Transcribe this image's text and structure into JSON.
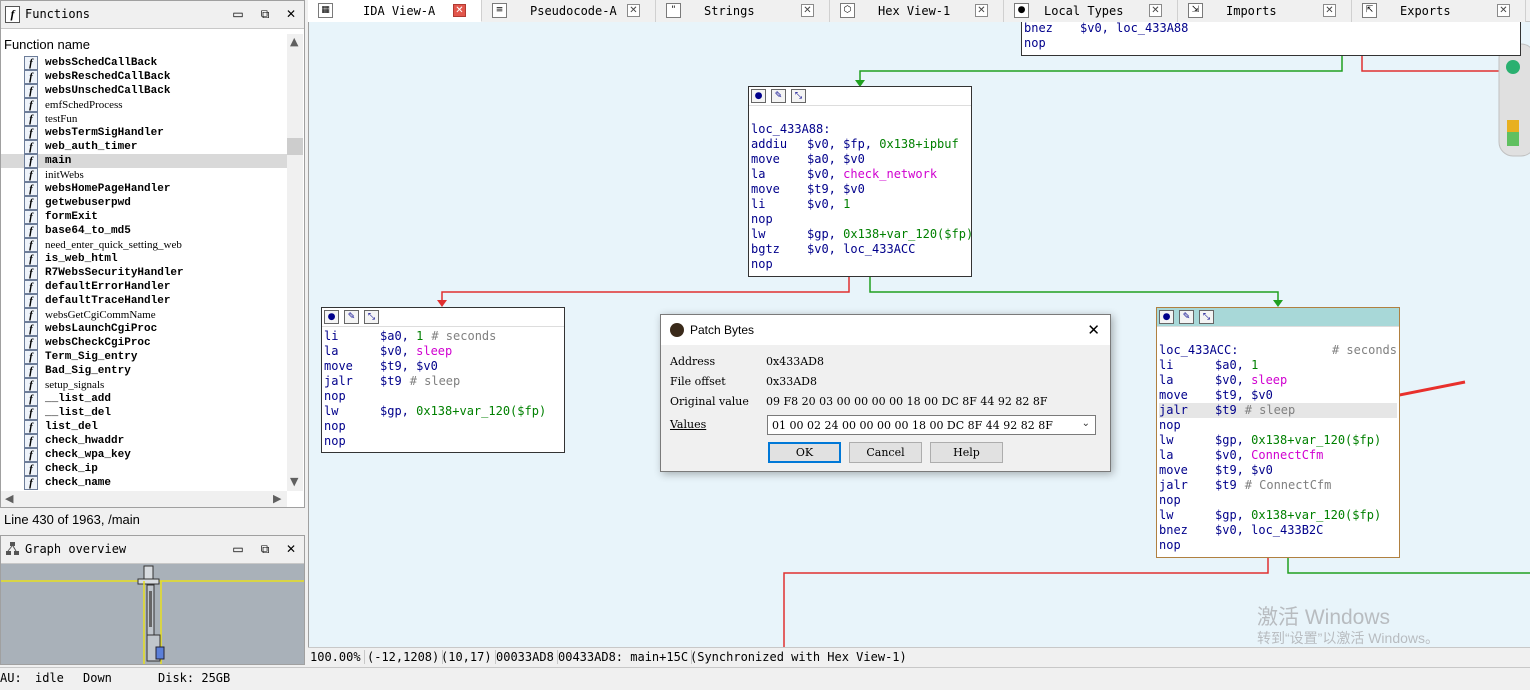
{
  "functions_panel": {
    "title": "Functions",
    "column_header": "Function name",
    "items": [
      {
        "name": "websSchedCallBack",
        "bold": true
      },
      {
        "name": "websReschedCallBack",
        "bold": true
      },
      {
        "name": "websUnschedCallBack",
        "bold": true
      },
      {
        "name": "emfSchedProcess",
        "bold": false
      },
      {
        "name": "testFun",
        "bold": false
      },
      {
        "name": "websTermSigHandler",
        "bold": true
      },
      {
        "name": "web_auth_timer",
        "bold": true
      },
      {
        "name": "main",
        "bold": true,
        "selected": true
      },
      {
        "name": "initWebs",
        "bold": false
      },
      {
        "name": "websHomePageHandler",
        "bold": true
      },
      {
        "name": "getwebuserpwd",
        "bold": true
      },
      {
        "name": "formExit",
        "bold": true
      },
      {
        "name": "base64_to_md5",
        "bold": true
      },
      {
        "name": "need_enter_quick_setting_web",
        "bold": false
      },
      {
        "name": "is_web_html",
        "bold": true
      },
      {
        "name": "R7WebsSecurityHandler",
        "bold": true
      },
      {
        "name": "defaultErrorHandler",
        "bold": true
      },
      {
        "name": "defaultTraceHandler",
        "bold": true
      },
      {
        "name": "websGetCgiCommName",
        "bold": false
      },
      {
        "name": "websLaunchCgiProc",
        "bold": true
      },
      {
        "name": "websCheckCgiProc",
        "bold": true
      },
      {
        "name": "Term_Sig_entry",
        "bold": true
      },
      {
        "name": "Bad_Sig_entry",
        "bold": true
      },
      {
        "name": "setup_signals",
        "bold": false
      },
      {
        "name": "__list_add",
        "bold": true
      },
      {
        "name": "__list_del",
        "bold": true
      },
      {
        "name": "list_del",
        "bold": true
      },
      {
        "name": "check_hwaddr",
        "bold": true
      },
      {
        "name": "check_wpa_key",
        "bold": true
      },
      {
        "name": "check_ip",
        "bold": true
      },
      {
        "name": "check_name",
        "bold": true
      }
    ],
    "line_status": "Line 430 of 1963, /main"
  },
  "graph_overview": {
    "title": "Graph overview"
  },
  "bottom_status": {
    "au_label": "AU:",
    "au_value": "idle",
    "direction": "Down",
    "disk": "Disk: 25GB"
  },
  "tabs": [
    {
      "label": "IDA View-A",
      "icon": "graph-icon",
      "active": true
    },
    {
      "label": "Pseudocode-A",
      "icon": "code-icon",
      "active": false
    },
    {
      "label": "Strings",
      "icon": "strings-icon",
      "active": false
    },
    {
      "label": "Hex View-1",
      "icon": "hex-icon",
      "active": false
    },
    {
      "label": "Local Types",
      "icon": "types-icon",
      "active": false
    },
    {
      "label": "Imports",
      "icon": "imports-icon",
      "active": false
    },
    {
      "label": "Exports",
      "icon": "exports-icon",
      "active": false
    }
  ],
  "nodes": {
    "top": {
      "lines": [
        {
          "mn": "bnez",
          "op": "$v0, loc_433A88"
        },
        {
          "mn": "nop",
          "op": ""
        }
      ]
    },
    "a88": {
      "label": "loc_433A88:",
      "lines": [
        {
          "mn": "addiu",
          "op": "$v0, $fp, ",
          "num": "0x138+ipbuf"
        },
        {
          "mn": "move",
          "op": "$a0, $v0"
        },
        {
          "mn": "la",
          "op": "$v0, ",
          "sym": "check_network"
        },
        {
          "mn": "move",
          "op": "$t9, $v0"
        },
        {
          "mn": "li",
          "op": "$v0, ",
          "num": "1"
        },
        {
          "mn": "nop",
          "op": ""
        },
        {
          "mn": "lw",
          "op": "$gp, ",
          "num": "0x138+var_120($fp)"
        },
        {
          "mn": "bgtz",
          "op": "$v0, loc_433ACC"
        },
        {
          "mn": "nop",
          "op": ""
        }
      ]
    },
    "left": {
      "lines": [
        {
          "mn": "li",
          "op": "$a0, ",
          "num": "1",
          "cmt": "# seconds"
        },
        {
          "mn": "la",
          "op": "$v0, ",
          "sym": "sleep"
        },
        {
          "mn": "move",
          "op": "$t9, $v0"
        },
        {
          "mn": "jalr",
          "op": "$t9",
          "cmt": "# sleep"
        },
        {
          "mn": "nop",
          "op": ""
        },
        {
          "mn": "lw",
          "op": "$gp, ",
          "num": "0x138+var_120($fp)"
        },
        {
          "mn": "nop",
          "op": ""
        },
        {
          "mn": "nop",
          "op": ""
        }
      ]
    },
    "acc": {
      "label": "loc_433ACC:",
      "label_comment": "# seconds",
      "lines": [
        {
          "mn": "li",
          "op": "$a0, ",
          "num": "1"
        },
        {
          "mn": "la",
          "op": "$v0, ",
          "sym": "sleep"
        },
        {
          "mn": "move",
          "op": "$t9, $v0"
        },
        {
          "mn": "jalr",
          "op": "$t9",
          "cmt": "# sleep",
          "hl": true
        },
        {
          "mn": "nop",
          "op": ""
        },
        {
          "mn": "lw",
          "op": "$gp, ",
          "num": "0x138+var_120($fp)"
        },
        {
          "mn": "la",
          "op": "$v0, ",
          "sym": "ConnectCfm"
        },
        {
          "mn": "move",
          "op": "$t9, $v0"
        },
        {
          "mn": "jalr",
          "op": "$t9",
          "cmt": "# ConnectCfm"
        },
        {
          "mn": "nop",
          "op": ""
        },
        {
          "mn": "lw",
          "op": "$gp, ",
          "num": "0x138+var_120($fp)"
        },
        {
          "mn": "bnez",
          "op": "$v0, loc_433B2C"
        },
        {
          "mn": "nop",
          "op": ""
        }
      ]
    }
  },
  "patch_dialog": {
    "title": "Patch Bytes",
    "address_label": "Address",
    "address_value": "0x433AD8",
    "file_offset_label": "File offset",
    "file_offset_value": "0x33AD8",
    "original_label": "Original value",
    "original_value": "09 F8 20 03 00 00 00 00 18 00 DC 8F 44 92 82 8F",
    "values_label": "Values",
    "values_value": "01 00 02 24 00 00 00 00 18 00 DC 8F 44 92 82 8F",
    "ok": "OK",
    "cancel": "Cancel",
    "help": "Help"
  },
  "view_status": {
    "zoom": "100.00%",
    "coords1": "(-12,1208)",
    "coords2": "(10,17)",
    "offset": "00033AD8",
    "address": "00433AD8: main+15C",
    "sync": "(Synchronized with Hex View-1)"
  },
  "watermark": {
    "line1": "激活 Windows",
    "line2": "转到“设置”以激活 Windows。"
  },
  "colors": {
    "graph_bg": "#e8f4fa",
    "edge_red": "#e03030",
    "edge_green": "#20a020",
    "pointer_arrow": "#e8302c"
  }
}
